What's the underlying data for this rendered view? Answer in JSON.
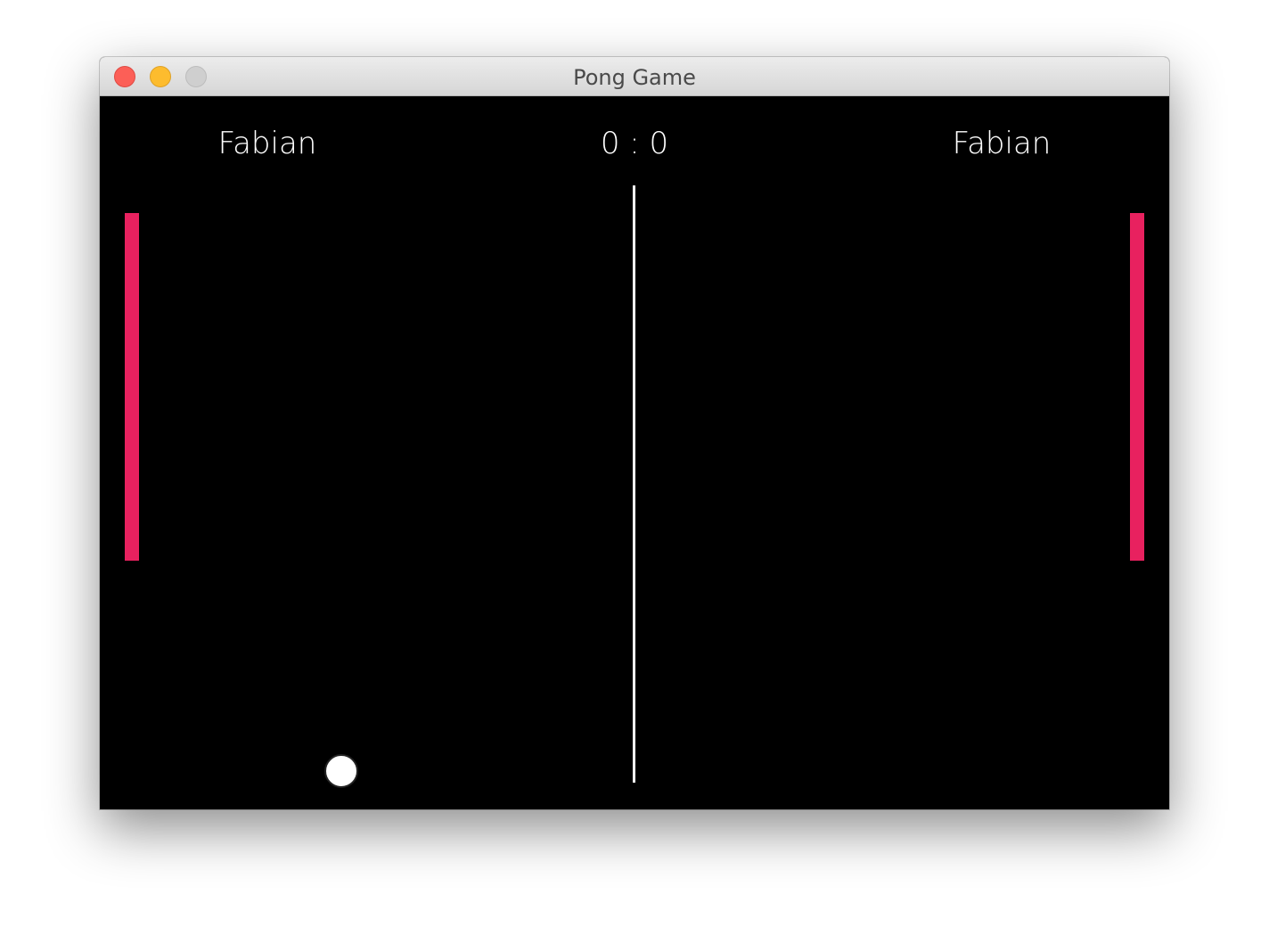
{
  "window": {
    "title": "Pong Game",
    "controls": [
      "close",
      "minimize",
      "zoom"
    ]
  },
  "game": {
    "player_left": {
      "name": "Fabian"
    },
    "player_right": {
      "name": "Fabian"
    },
    "score": "0 : 0",
    "colors": {
      "background": "#000000",
      "paddle": "#e8215f",
      "ball": "#ffffff",
      "net": "#ffffff",
      "text": "#ffffff"
    }
  }
}
